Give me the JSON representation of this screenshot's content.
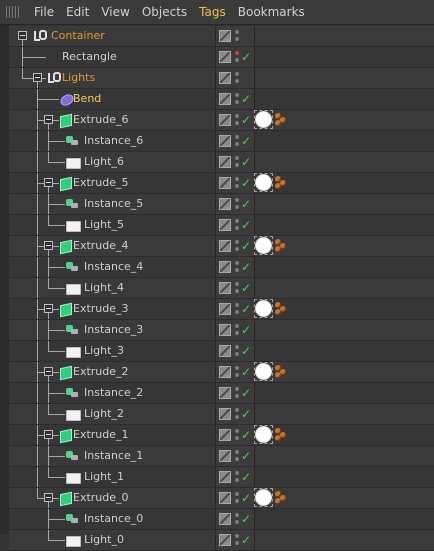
{
  "menubar": {
    "items": [
      "File",
      "Edit",
      "View",
      "Objects",
      "Tags",
      "Bookmarks"
    ],
    "active": "Tags"
  },
  "objects": [
    {
      "name": "Container",
      "type": "null",
      "color": "orange",
      "depth": 0
    },
    {
      "name": "Rectangle",
      "type": "rectangle",
      "color": "grey",
      "depth": 1,
      "vis_red": true
    },
    {
      "name": "Lights",
      "type": "null",
      "color": "orange",
      "depth": 1
    },
    {
      "name": "Bend",
      "type": "bend",
      "color": "yellow",
      "depth": 2
    },
    {
      "name": "Extrude_6",
      "type": "extrude",
      "color": "grey",
      "depth": 2,
      "tags": true
    },
    {
      "name": "Instance_6",
      "type": "instance",
      "color": "grey",
      "depth": 3
    },
    {
      "name": "Light_6",
      "type": "light",
      "color": "grey",
      "depth": 3
    },
    {
      "name": "Extrude_5",
      "type": "extrude",
      "color": "grey",
      "depth": 2,
      "tags": true
    },
    {
      "name": "Instance_5",
      "type": "instance",
      "color": "grey",
      "depth": 3
    },
    {
      "name": "Light_5",
      "type": "light",
      "color": "grey",
      "depth": 3
    },
    {
      "name": "Extrude_4",
      "type": "extrude",
      "color": "grey",
      "depth": 2,
      "tags": true
    },
    {
      "name": "Instance_4",
      "type": "instance",
      "color": "grey",
      "depth": 3
    },
    {
      "name": "Light_4",
      "type": "light",
      "color": "grey",
      "depth": 3
    },
    {
      "name": "Extrude_3",
      "type": "extrude",
      "color": "grey",
      "depth": 2,
      "tags": true
    },
    {
      "name": "Instance_3",
      "type": "instance",
      "color": "grey",
      "depth": 3
    },
    {
      "name": "Light_3",
      "type": "light",
      "color": "grey",
      "depth": 3
    },
    {
      "name": "Extrude_2",
      "type": "extrude",
      "color": "grey",
      "depth": 2,
      "tags": true
    },
    {
      "name": "Instance_2",
      "type": "instance",
      "color": "grey",
      "depth": 3
    },
    {
      "name": "Light_2",
      "type": "light",
      "color": "grey",
      "depth": 3
    },
    {
      "name": "Extrude_1",
      "type": "extrude",
      "color": "grey",
      "depth": 2,
      "tags": true
    },
    {
      "name": "Instance_1",
      "type": "instance",
      "color": "grey",
      "depth": 3
    },
    {
      "name": "Light_1",
      "type": "light",
      "color": "grey",
      "depth": 3
    },
    {
      "name": "Extrude_0",
      "type": "extrude",
      "color": "grey",
      "depth": 2,
      "tags": true
    },
    {
      "name": "Instance_0",
      "type": "instance",
      "color": "grey",
      "depth": 3
    },
    {
      "name": "Light_0",
      "type": "light",
      "color": "grey",
      "depth": 3
    }
  ],
  "colors": {
    "orange": "#e39a2a",
    "yellow": "#f2d15b",
    "check": "#3fd45a"
  }
}
